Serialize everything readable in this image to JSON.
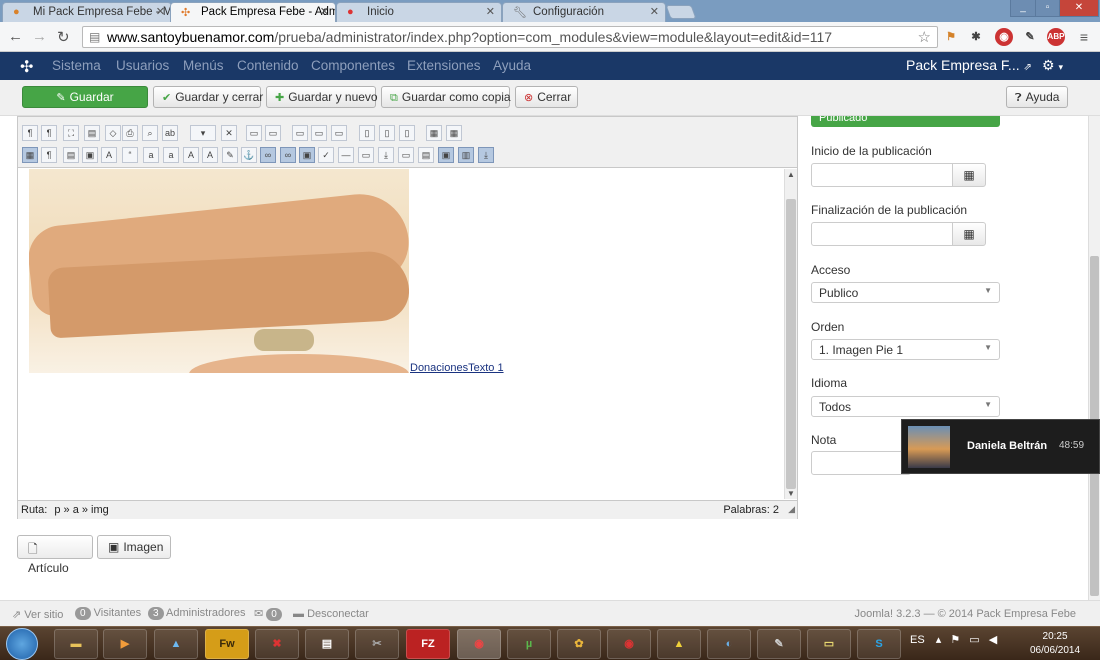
{
  "browser": {
    "tabs": [
      {
        "title": "Mi Pack Empresa Febe - M",
        "icon": "cp-icon"
      },
      {
        "title": "Pack Empresa Febe - Adm",
        "icon": "joomla-icon"
      },
      {
        "title": "Inicio",
        "icon": "flame-icon"
      },
      {
        "title": "Configuración",
        "icon": "wrench-icon"
      }
    ],
    "url_host": "www.santoybuenamor.com",
    "url_rest": "/prueba/administrator/index.php?option=com_modules&view=module&layout=edit&id=117",
    "ext_abp": "ABP"
  },
  "adminnav": {
    "menu": [
      "Sistema",
      "Usuarios",
      "Menús",
      "Contenido",
      "Componentes",
      "Extensiones",
      "Ayuda"
    ],
    "site_title": "Pack Empresa F..."
  },
  "toolbar": {
    "save": "Guardar",
    "save_close": "Guardar y cerrar",
    "save_new": "Guardar y nuevo",
    "save_copy": "Guardar como copia",
    "close": "Cerrar",
    "help": "Ayuda"
  },
  "editor": {
    "image_link": "DonacionesTexto 1",
    "path_label": "Ruta:",
    "path": "p » a » img",
    "words": "Palabras: 2",
    "insert_article": "Artículo",
    "insert_image": "Imagen"
  },
  "panel": {
    "published_label": "Publicado",
    "publish_up_label": "Inicio de la publicación",
    "publish_down_label": "Finalización de la publicación",
    "access_label": "Acceso",
    "access_value": "Publico",
    "order_label": "Orden",
    "order_value": "1. Imagen Pie 1",
    "language_label": "Idioma",
    "language_value": "Todos",
    "note_label": "Nota"
  },
  "notification": {
    "name": "Daniela Beltrán",
    "time": "48:59"
  },
  "footer": {
    "view_site": "Ver sitio",
    "visitors_count": "0",
    "visitors_label": "Visitantes",
    "admins_count": "3",
    "admins_label": "Administradores",
    "msgs_count": "0",
    "logout": "Desconectar",
    "copyright": "Joomla! 3.2.3 — © 2014 Pack Empresa Febe"
  },
  "taskbar": {
    "fw_label": "Fw",
    "fz_label": "FZ",
    "lang": "ES",
    "time": "20:25",
    "date": "06/06/2014"
  }
}
